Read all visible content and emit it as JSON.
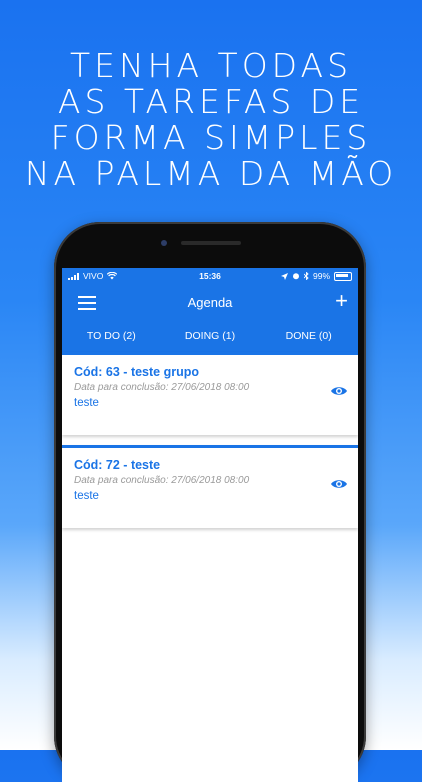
{
  "headline": [
    "TENHA TODAS",
    "AS TAREFAS DE",
    "FORMA SIMPLES",
    "NA PALMA DA MÃO"
  ],
  "status_bar": {
    "carrier": "VIVO",
    "time": "15:36",
    "battery": "99%"
  },
  "navbar": {
    "title": "Agenda",
    "menu_icon": "menu-icon",
    "add_icon": "plus-icon"
  },
  "tabs": [
    {
      "label": "TO DO (2)"
    },
    {
      "label": "DOING (1)"
    },
    {
      "label": "DONE (0)"
    }
  ],
  "tasks": [
    {
      "title": "Cód: 63 - teste grupo",
      "date": "Data para conclusão: 27/06/2018 08:00",
      "description": "teste",
      "icon": "eye-icon"
    },
    {
      "title": "Cód: 72 - teste",
      "date": "Data para conclusão: 27/06/2018 08:00",
      "description": "teste",
      "icon": "eye-icon"
    }
  ],
  "colors": {
    "accent": "#1a74e6",
    "background_top": "#1a72f0",
    "text_muted": "#9a9a9a"
  }
}
